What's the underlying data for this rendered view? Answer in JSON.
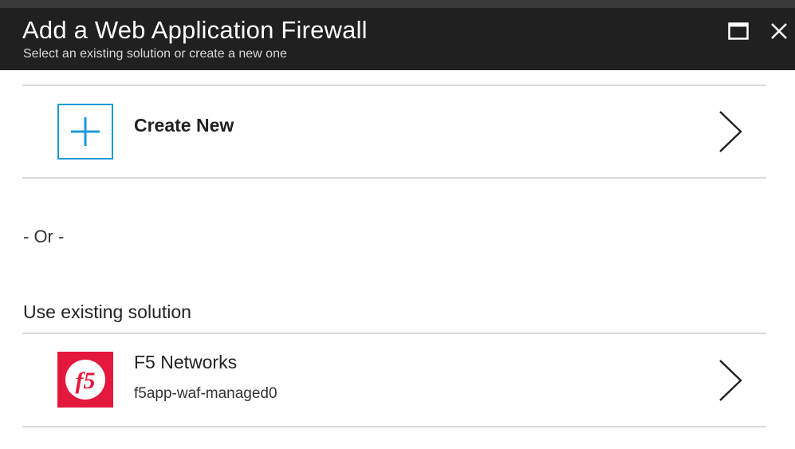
{
  "window": {
    "title": "Add a Web Application Firewall",
    "subtitle": "Select an existing solution or create a new one"
  },
  "create_new": {
    "label": "Create New",
    "icon": "plus-icon",
    "accent_color": "#1a9ad9"
  },
  "separator_text": "- Or -",
  "existing": {
    "heading": "Use existing solution",
    "items": [
      {
        "name": "F5 Networks",
        "detail": "f5app-waf-managed0",
        "logo_text": "f5",
        "logo_color": "#e4173c"
      }
    ]
  },
  "colors": {
    "header_bg": "#202020",
    "divider": "#d9d9d9"
  }
}
